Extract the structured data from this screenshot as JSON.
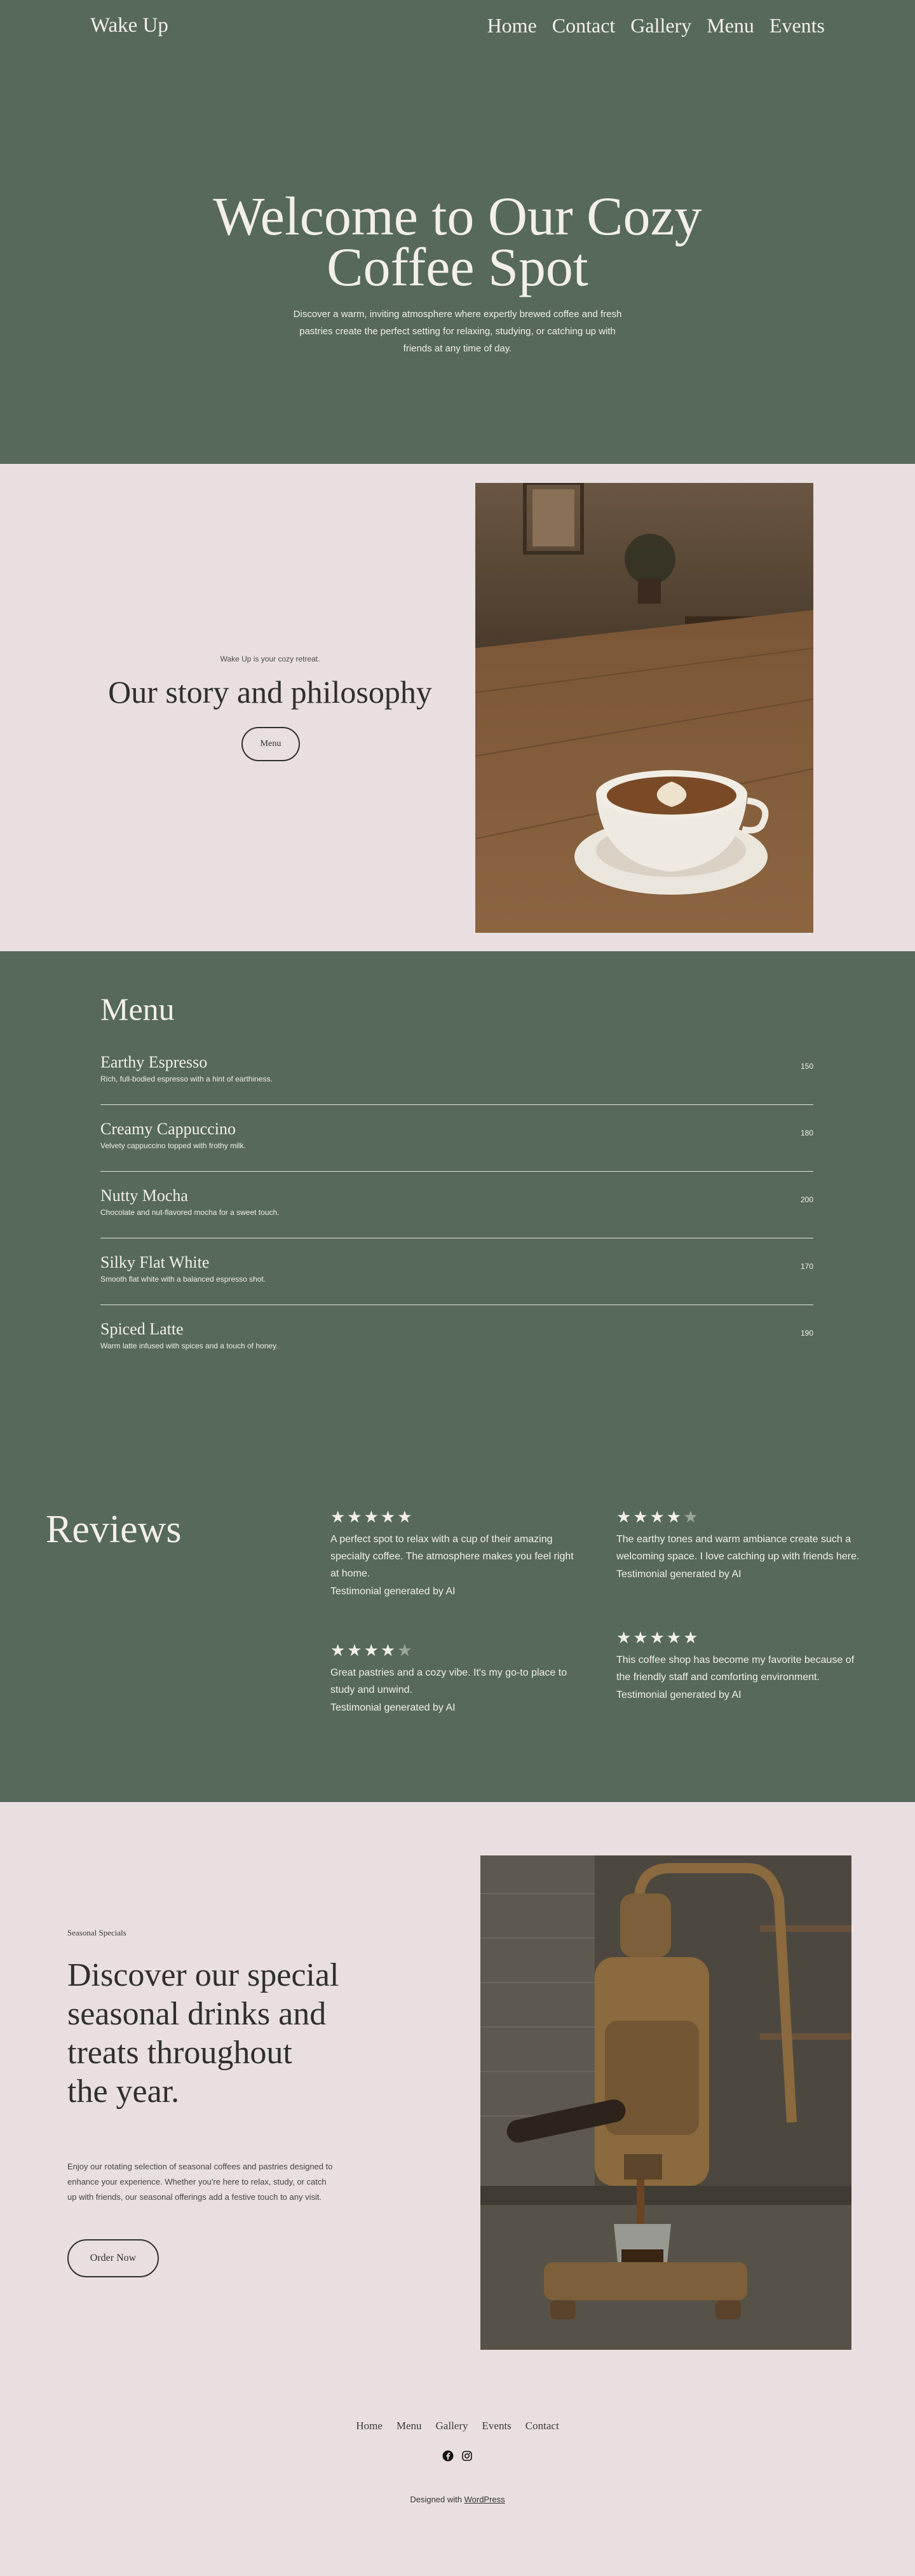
{
  "site": {
    "brand": "Wake Up"
  },
  "nav": {
    "items": [
      "Home",
      "Contact",
      "Gallery",
      "Menu",
      "Events"
    ]
  },
  "hero": {
    "title": "Welcome to Our Cozy Coffee Spot",
    "subtitle": "Discover a warm, inviting atmosphere where expertly brewed coffee and fresh pastries create the perfect setting for relaxing, studying, or catching up with friends at any time of day."
  },
  "story": {
    "kicker": "Wake Up is your cozy retreat.",
    "title": "Our story and philosophy",
    "button": "Menu"
  },
  "menu": {
    "heading": "Menu",
    "items": [
      {
        "name": "Earthy Espresso",
        "desc": "Rich, full-bodied espresso with a hint of earthiness.",
        "price": "150"
      },
      {
        "name": "Creamy Cappuccino",
        "desc": "Velvety cappuccino topped with frothy milk.",
        "price": "180"
      },
      {
        "name": "Nutty Mocha",
        "desc": "Chocolate and nut-flavored mocha for a sweet touch.",
        "price": "200"
      },
      {
        "name": "Silky Flat White",
        "desc": "Smooth flat white with a balanced espresso shot.",
        "price": "170"
      },
      {
        "name": "Spiced Latte",
        "desc": "Warm latte infused with spices and a touch of honey.",
        "price": "190"
      }
    ]
  },
  "reviews": {
    "heading": "Reviews",
    "items": [
      {
        "rating": 5,
        "text": "A perfect spot to relax with a cup of their amazing specialty coffee. The atmosphere makes you feel right at home.",
        "by": "Testimonial generated by AI"
      },
      {
        "rating": 4,
        "text": "The earthy tones and warm ambiance create such a welcoming space. I love catching up with friends here.",
        "by": "Testimonial generated by AI"
      },
      {
        "rating": 4,
        "text": "Great pastries and a cozy vibe. It's my go-to place to study and unwind.",
        "by": "Testimonial generated by AI"
      },
      {
        "rating": 5,
        "text": "This coffee shop has become my favorite because of the friendly staff and comforting environment.",
        "by": "Testimonial generated by AI"
      }
    ]
  },
  "seasonal": {
    "kicker": "Seasonal Specials",
    "title": "Discover our special seasonal drinks and treats throughout the year.",
    "body": "Enjoy our rotating selection of seasonal coffees and pastries designed to enhance your experience. Whether you're here to relax, study, or catch up with friends, our seasonal offerings add a festive touch to any visit.",
    "button": "Order Now"
  },
  "footer": {
    "nav": [
      "Home",
      "Menu",
      "Gallery",
      "Events",
      "Contact"
    ],
    "credit_prefix": "Designed with",
    "credit_link": "WordPress"
  },
  "colors": {
    "green": "#56695b",
    "blush": "#e9dfe1",
    "cream": "#f3efe8"
  },
  "icons": [
    "facebook-icon",
    "instagram-icon"
  ]
}
